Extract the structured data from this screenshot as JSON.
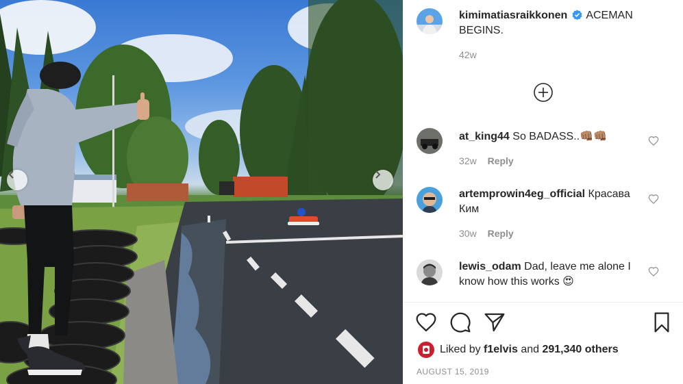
{
  "post": {
    "author": "kimimatiasraikkonen",
    "caption": "ACEMAN BEGINS.",
    "age": "42w",
    "date": "AUGUST 15, 2019"
  },
  "comments": [
    {
      "user": "at_king44",
      "text": "So BADASS..",
      "emoji": "👊🏽👊🏽",
      "age": "32w",
      "reply": "Reply"
    },
    {
      "user": "artemprowin4eg_official",
      "text": "Красава Ким",
      "age": "30w",
      "reply": "Reply"
    },
    {
      "user": "lewis_odam",
      "text": "Dad, leave me alone I know how this works",
      "emoji": "😍"
    }
  ],
  "likes": {
    "prefix": "Liked by",
    "liker": "f1elvis",
    "and": "and",
    "count": "291,340 others"
  },
  "icons": {
    "verified": "verified-badge-icon",
    "load_more": "plus-circle-icon",
    "like": "heart-icon",
    "comment": "comment-bubble-icon",
    "share": "paper-plane-icon",
    "save": "bookmark-icon",
    "nav_prev": "chevron-left-icon",
    "nav_next": "chevron-right-icon"
  },
  "colors": {
    "verified": "#3897f0",
    "text": "#262626",
    "muted": "#8e8e8e",
    "divider": "#efefef"
  }
}
